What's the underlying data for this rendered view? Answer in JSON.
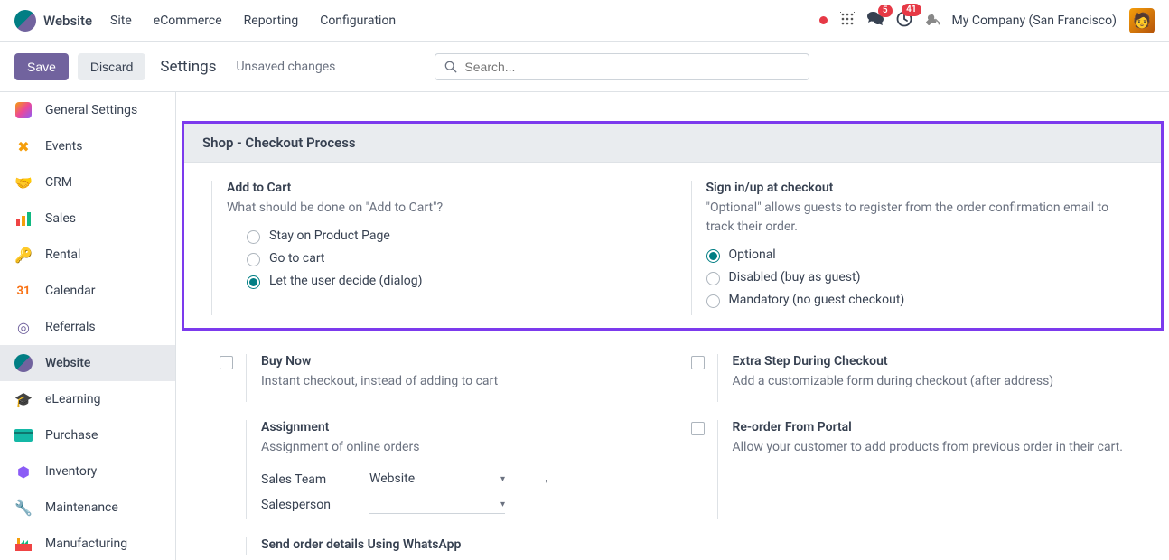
{
  "navbar": {
    "brand": "Website",
    "links": [
      "Site",
      "eCommerce",
      "Reporting",
      "Configuration"
    ],
    "messages_badge": "5",
    "activities_badge": "41",
    "company": "My Company (San Francisco)"
  },
  "control": {
    "save": "Save",
    "discard": "Discard",
    "title": "Settings",
    "unsaved": "Unsaved changes",
    "search_placeholder": "Search..."
  },
  "sidebar": {
    "items": [
      {
        "label": "General Settings",
        "icon": "⚙️",
        "color": "#875a7b"
      },
      {
        "label": "Events",
        "icon": "✖",
        "color": "#f59e0b"
      },
      {
        "label": "CRM",
        "icon": "🤝",
        "color": "#0ea5e9"
      },
      {
        "label": "Sales",
        "icon": "📊",
        "color": "#ef4444"
      },
      {
        "label": "Rental",
        "icon": "🔑",
        "color": "#0ea5e9"
      },
      {
        "label": "Calendar",
        "icon": "31",
        "color": "#f97316"
      },
      {
        "label": "Referrals",
        "icon": "◎",
        "color": "#71639e"
      },
      {
        "label": "Website",
        "icon": "◐",
        "color": "#017e84"
      },
      {
        "label": "eLearning",
        "icon": "🎓",
        "color": "#374151"
      },
      {
        "label": "Purchase",
        "icon": "▬",
        "color": "#14b8a6"
      },
      {
        "label": "Inventory",
        "icon": "⬢",
        "color": "#8b5cf6"
      },
      {
        "label": "Maintenance",
        "icon": "🔧",
        "color": "#0ea5e9"
      },
      {
        "label": "Manufacturing",
        "icon": "🏭",
        "color": "#ef4444"
      }
    ],
    "active_index": 7
  },
  "section": {
    "header": "Shop - Checkout Process",
    "add_to_cart": {
      "title": "Add to Cart",
      "desc": "What should be done on \"Add to Cart\"?",
      "options": [
        "Stay on Product Page",
        "Go to cart",
        "Let the user decide (dialog)"
      ],
      "selected": 2
    },
    "signin": {
      "title": "Sign in/up at checkout",
      "desc": "\"Optional\" allows guests to register from the order confirmation email to track their order.",
      "options": [
        "Optional",
        "Disabled (buy as guest)",
        "Mandatory (no guest checkout)"
      ],
      "selected": 0
    },
    "buy_now": {
      "title": "Buy Now",
      "desc": "Instant checkout, instead of adding to cart"
    },
    "extra_step": {
      "title": "Extra Step During Checkout",
      "desc": "Add a customizable form during checkout (after address)"
    },
    "assignment": {
      "title": "Assignment",
      "desc": "Assignment of online orders",
      "sales_team_label": "Sales Team",
      "sales_team_value": "Website",
      "salesperson_label": "Salesperson",
      "salesperson_value": ""
    },
    "reorder": {
      "title": "Re-order From Portal",
      "desc": "Allow your customer to add products from previous order in their cart."
    },
    "whatsapp": {
      "title": "Send order details Using WhatsApp"
    }
  }
}
